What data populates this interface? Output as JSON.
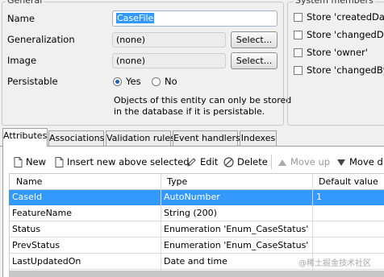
{
  "general": {
    "legend": "General",
    "name_label": "Name",
    "name_value": "CaseFile",
    "generalization_label": "Generalization",
    "generalization_value": "(none)",
    "image_label": "Image",
    "image_value": "(none)",
    "select_label": "Select...",
    "persistable_label": "Persistable",
    "yes_label": "Yes",
    "no_label": "No",
    "persistable_selected": "Yes",
    "note_line1": "Objects of this entity can only be stored",
    "note_line2": "in the database if it is persistable."
  },
  "system_members": {
    "legend": "System members",
    "items": [
      "Store 'createdDate",
      "Store 'changedDate",
      "Store 'owner'",
      "Store 'changedBy'"
    ]
  },
  "tabs": [
    "Attributes",
    "Associations",
    "Validation rules",
    "Event handlers",
    "Indexes"
  ],
  "active_tab": "Attributes",
  "toolbar": {
    "new": "New",
    "insert": "Insert new above selected",
    "edit": "Edit",
    "delete": "Delete",
    "move_up": "Move up",
    "move_down": "Move d"
  },
  "table": {
    "columns": [
      "Name",
      "Type",
      "Default value"
    ],
    "rows": [
      {
        "name": "CaseId",
        "type": "AutoNumber",
        "default": "1",
        "selected": true
      },
      {
        "name": "FeatureName",
        "type": "String (200)",
        "default": ""
      },
      {
        "name": "Status",
        "type": "Enumeration 'Enum_CaseStatus'",
        "default": ""
      },
      {
        "name": "PrevStatus",
        "type": "Enumeration 'Enum_CaseStatus'",
        "default": ""
      },
      {
        "name": "LastUpdatedOn",
        "type": "Date and time",
        "default": ""
      }
    ]
  },
  "watermark": "@稀土掘金技术社区",
  "colors": {
    "selection": "#3399ff",
    "accent": "#1a5fb4"
  }
}
